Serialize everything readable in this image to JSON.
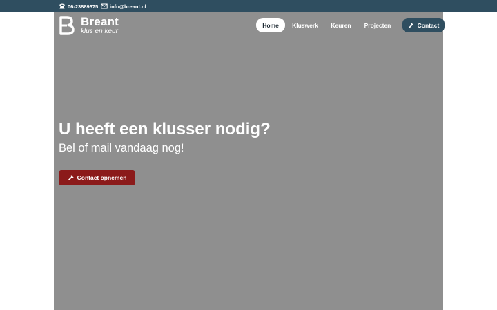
{
  "topbar": {
    "phone": {
      "icon": "phone-icon",
      "text": "06-23889375"
    },
    "email": {
      "icon": "mail-icon",
      "text": "info@breant.nl"
    }
  },
  "logo": {
    "name": "Breant",
    "tagline": "klus en keur"
  },
  "nav": {
    "items": [
      {
        "label": "Home",
        "active": true
      },
      {
        "label": "Kluswerk",
        "active": false
      },
      {
        "label": "Keuren",
        "active": false
      },
      {
        "label": "Projecten",
        "active": false
      }
    ],
    "contact": {
      "label": "Contact",
      "icon": "hammer-icon"
    }
  },
  "hero": {
    "headline": "U heeft een klusser nodig?",
    "subline": "Bel of mail vandaag nog!",
    "cta": {
      "label": "Contact opnemen",
      "icon": "hammer-icon"
    }
  },
  "colors": {
    "topbar": "#2f4e60",
    "hero_background": "#8f8f8f",
    "cta": "#8b1a1a",
    "nav_active": "#ffffff"
  }
}
